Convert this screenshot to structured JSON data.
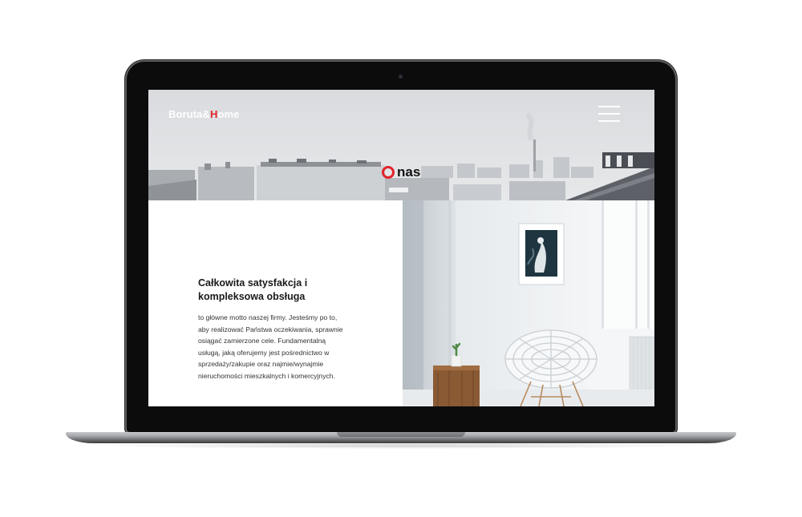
{
  "header": {
    "logo_part1": "Boruta",
    "logo_amp": "&",
    "logo_accent": "H",
    "logo_part2": "ome",
    "menu_icon": "hamburger-icon"
  },
  "hero": {
    "title_rest": "nas",
    "title_icon": "ring-o-icon"
  },
  "content": {
    "heading_line1": "Całkowita satysfakcja i",
    "heading_line2": "kompleksowa obsługa",
    "body_lines": [
      "to główne motto naszej firmy. Jesteśmy po to,",
      "aby realizować Państwa oczekiwania, sprawnie",
      "osiągać zamierzone cele. Fundamentalną",
      "usługą, jaką oferujemy jest pośrednictwo w",
      "sprzedaży/zakupie oraz najmie/wynajmie",
      "nieruchomości mieszkalnych i komercyjnych."
    ]
  },
  "colors": {
    "accent": "#e1242b",
    "device": "#0c0c0d"
  }
}
